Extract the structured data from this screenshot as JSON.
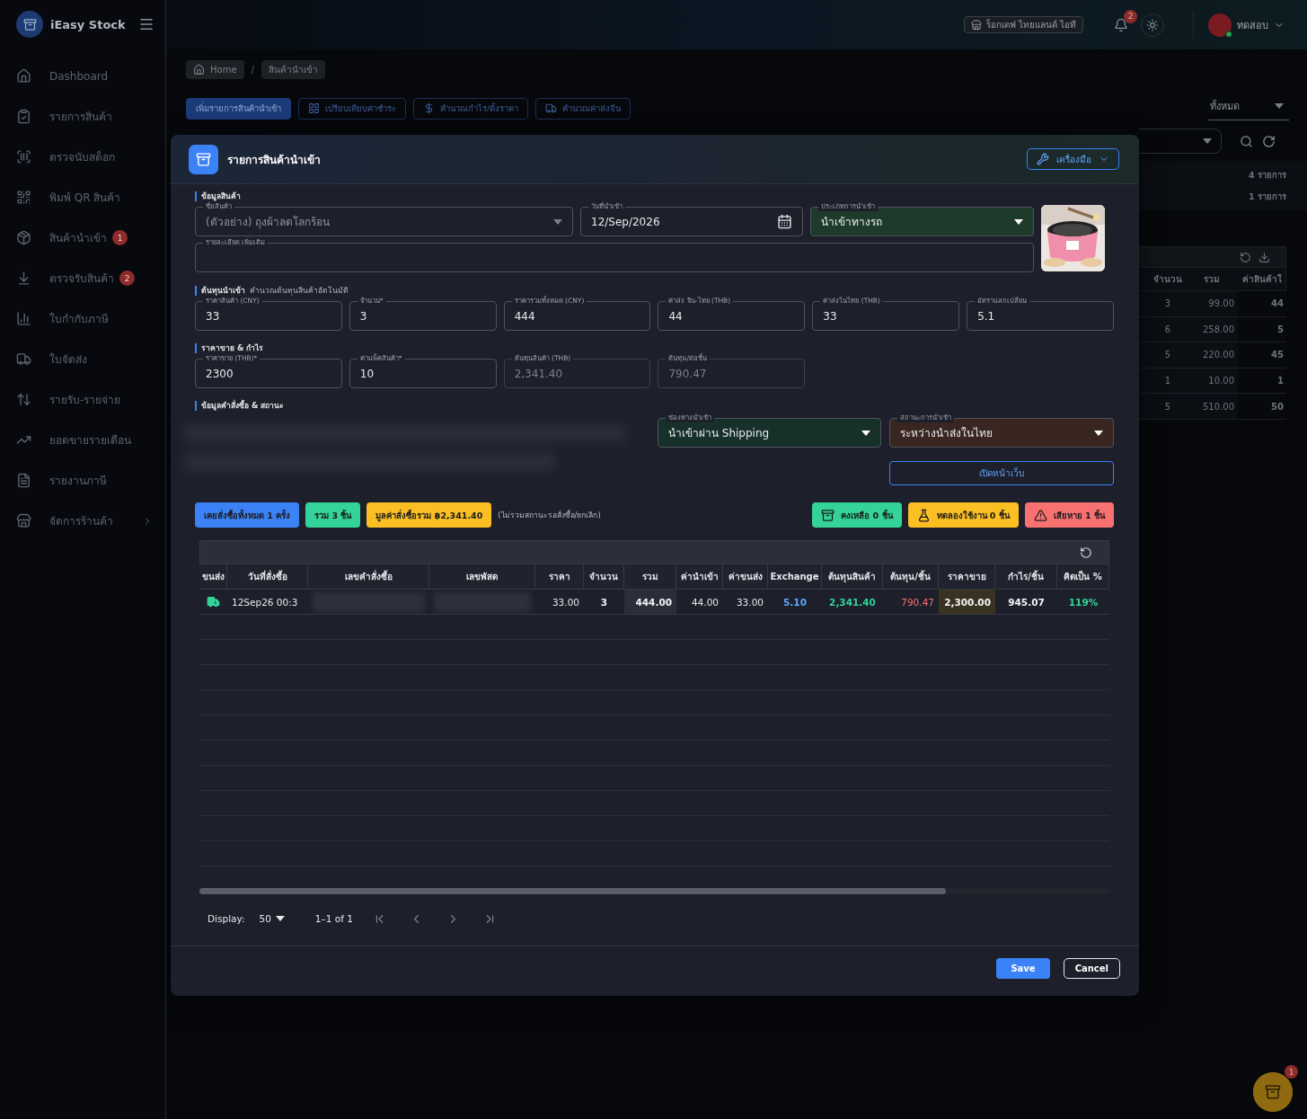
{
  "sidebar": {
    "brand": "iEasy Stock",
    "items": [
      {
        "label": "Dashboard"
      },
      {
        "label": "รายการสินค้า"
      },
      {
        "label": "ตรวจนับสต็อก"
      },
      {
        "label": "พิมพ์ QR สินค้า"
      },
      {
        "label": "สินค้านำเข้า",
        "badge": "1"
      },
      {
        "label": "ตรวจรับสินค้า",
        "badge": "2"
      },
      {
        "label": "ใบกำกับภาษี"
      },
      {
        "label": "ใบจัดส่ง"
      },
      {
        "label": "รายรับ-รายจ่าย"
      },
      {
        "label": "ยอดขายรายเดือน"
      },
      {
        "label": "รายงานภาษี"
      },
      {
        "label": "จัดการร้านค้า",
        "has_submenu": true
      }
    ]
  },
  "topbar": {
    "store": "ร็อกเดฟ ไทยแลนด์ ไอที",
    "notifications": "2",
    "user": "ทดสอบ"
  },
  "breadcrumb": {
    "items": [
      "Home",
      "สินค้านำเข้า"
    ],
    "separator": "/"
  },
  "actions": [
    {
      "label": "เพิ่มรายการสินค้านำเข้า",
      "primary": true
    },
    {
      "label": "เปรียบเทียบค่าชำระ",
      "primary": false
    },
    {
      "label": "คำนวณกำไร/ตั้งราคา",
      "primary": false
    },
    {
      "label": "คำนวณค่าส่งจีน",
      "primary": false
    }
  ],
  "filter": {
    "value": "ทั้งหมด"
  },
  "summary": [
    "4 รายการ",
    "1 รายการ"
  ],
  "background_table": {
    "columns": [
      "จำนวน",
      "รวม",
      "ค่าสินค้าใ"
    ],
    "rows": [
      [
        "3",
        "99.00",
        "44"
      ],
      [
        "6",
        "258.00",
        "5"
      ],
      [
        "5",
        "220.00",
        "45"
      ],
      [
        "1",
        "10.00",
        "1"
      ],
      [
        "5",
        "510.00",
        "50"
      ]
    ]
  },
  "modal": {
    "title": "รายการสินค้านำเข้า",
    "tools_button": "เครื่องมือ",
    "product_section": {
      "heading": "ข้อมูลสินค้า",
      "name": {
        "label": "ชื่อสินค้า",
        "placeholder": "(ตัวอย่าง) ถุงผ้าลดโลกร้อน"
      },
      "date": {
        "label": "วันที่นำเข้า",
        "value": "12/Sep/2026"
      },
      "import_type": {
        "label": "ประเภทการนำเข้า",
        "value": "นำเข้าทางรถ",
        "color": "#1e3a2a"
      },
      "details": {
        "label": "รายละเอียด เพิ่มเติม"
      }
    },
    "cost_section": {
      "heading": "ต้นทุนนำเข้า",
      "note": "คำนวณต้นทุนสินค้าอัตโนมัติ",
      "fields": [
        {
          "label": "ราคาสินค้า (CNY)",
          "value": "33",
          "disabled": false
        },
        {
          "label": "จำนวน*",
          "value": "3",
          "disabled": false
        },
        {
          "label": "ราคารวมทั้งหมด (CNY)",
          "value": "444",
          "disabled": false
        },
        {
          "label": "ค่าส่ง จีน-ไทย (THB)",
          "value": "44",
          "disabled": false
        },
        {
          "label": "ค่าส่งในไทย (THB)",
          "value": "33",
          "disabled": false
        },
        {
          "label": "อัตราแลกเปลี่ยน",
          "value": "5.1",
          "disabled": false
        }
      ]
    },
    "price_section": {
      "heading": "ราคาขาย & กำไร",
      "fields": [
        {
          "label": "ราคาขาย (THB)*",
          "value": "2300",
          "disabled": false
        },
        {
          "label": "ค่าแพ็คสินค้า*",
          "value": "10",
          "disabled": false
        },
        {
          "label": "ต้นทุนสินค้า (THB)",
          "value": "2,341.40",
          "disabled": true
        },
        {
          "label": "ต้นทุน/ต่อชิ้น",
          "value": "790.47",
          "disabled": true
        }
      ]
    },
    "order_section": {
      "heading": "ข้อมูลคำสั่งซื้อ & สถานะ",
      "channel": {
        "label": "ช่องทางนำเข้า",
        "value": "นำเข้าผ่าน Shipping",
        "color": "#17302a"
      },
      "status": {
        "label": "สถานะการนำเข้า",
        "value": "ระหว่างนำส่งในไทย",
        "color": "#3a2620"
      },
      "web_button": "เปิดหน้าเว็บ"
    },
    "stats_left": [
      {
        "label": "เคยสั่งซื้อทั้งหมด 1 ครั้ง",
        "color": "#3b82f6"
      },
      {
        "label": "รวม 3 ชิ้น",
        "color": "#34d399"
      },
      {
        "label": "มูลค่าสั่งซื้อรวม ฿2,341.40",
        "color": "#fbbf24"
      }
    ],
    "stats_note": "(ไม่รวมสถานะรอสั่งซื้อ/ยกเลิก)",
    "stats_right": [
      {
        "label": "คงเหลือ 0 ชิ้น",
        "color": "#34d399"
      },
      {
        "label": "ทดลองใช้งาน 0 ชิ้น",
        "color": "#fbbf24"
      },
      {
        "label": "เสียหาย 1 ชิ้น",
        "color": "#f87171"
      }
    ],
    "orders_table": {
      "columns": [
        {
          "label": "ขนส่ง",
          "kind": "icon"
        },
        {
          "label": "วันที่สั่งซื้อ",
          "kind": "plain"
        },
        {
          "label": "เลขคำสั่งซื้อ",
          "kind": "redacted"
        },
        {
          "label": "เลขพัสด",
          "kind": "redacted"
        },
        {
          "label": "ราคา",
          "kind": "plain"
        },
        {
          "label": "จำนวน",
          "kind": "bold"
        },
        {
          "label": "รวม",
          "kind": "total"
        },
        {
          "label": "ค่านำเข้า",
          "kind": "plain"
        },
        {
          "label": "ค่าขนส่ง",
          "kind": "plain"
        },
        {
          "label": "Exchange",
          "kind": "rate"
        },
        {
          "label": "ต้นทุนสินค้า",
          "kind": "cost"
        },
        {
          "label": "ต้นทุน/ชิ้น",
          "kind": "unit"
        },
        {
          "label": "ราคาขาย",
          "kind": "price"
        },
        {
          "label": "กำไร/ชิ้น",
          "kind": "bold"
        },
        {
          "label": "คิดเป็น %",
          "kind": "cost"
        }
      ],
      "rows": [
        {
          "cells": [
            "",
            "12Sep26 00:3",
            "",
            "",
            "33.00",
            "3",
            "444.00",
            "44.00",
            "33.00",
            "5.10",
            "2,341.40",
            "790.47",
            "2,300.00",
            "945.07",
            "119%"
          ]
        }
      ]
    },
    "pagination": {
      "display_label": "Display:",
      "page_size": "50",
      "range": "1–1 of 1"
    },
    "buttons": {
      "save": "Save",
      "cancel": "Cancel"
    }
  },
  "fab_badge": "1"
}
